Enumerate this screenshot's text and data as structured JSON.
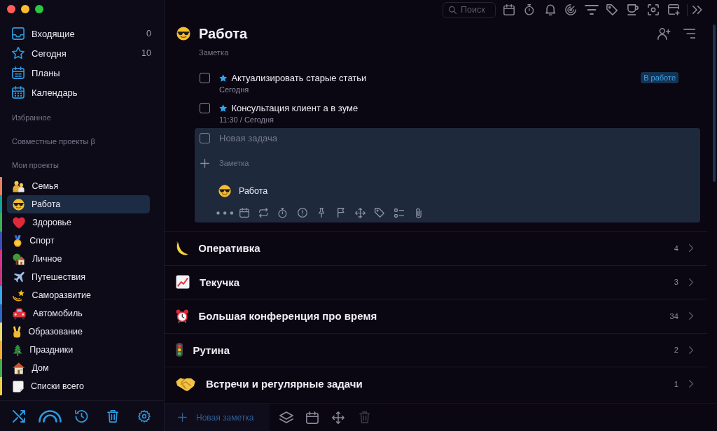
{
  "sidebar": {
    "nav": [
      {
        "kind": "inbox",
        "label": "Входящие",
        "count": "0",
        "selected": false
      },
      {
        "kind": "star",
        "label": "Сегодня",
        "count": "10",
        "selected": false
      },
      {
        "kind": "plans",
        "label": "Планы",
        "selected": false
      },
      {
        "kind": "calendar",
        "label": "Календарь",
        "selected": false
      }
    ],
    "favorites_heading": "Избранное",
    "shared_heading": "Совместные проекты β",
    "projects_heading": "Мои проекты",
    "projects": [
      {
        "kind": "family",
        "label": "Семья",
        "color": "#e8825a",
        "selected": false
      },
      {
        "kind": "cool",
        "label": "Работа",
        "color": "#14a394",
        "selected": true
      },
      {
        "kind": "heart",
        "label": "Здоровье",
        "color": "#3fae58",
        "selected": false
      },
      {
        "kind": "medal",
        "label": "Спорт",
        "color": "#3c4fbf",
        "selected": false
      },
      {
        "kind": "home-garden",
        "label": "Личное",
        "color": "#d6338a",
        "selected": false
      },
      {
        "kind": "airplane",
        "label": "Путешествия",
        "color": "#c8377d",
        "selected": false
      },
      {
        "kind": "dizzy",
        "label": "Саморазвитие",
        "color": "#39a6e6",
        "selected": false
      },
      {
        "kind": "car",
        "label": "Автомобиль",
        "color": "#2b68c6",
        "selected": false
      },
      {
        "kind": "victory",
        "label": "Образование",
        "color": "#e6de6e",
        "selected": false
      },
      {
        "kind": "tree",
        "label": "Праздники",
        "color": "#efae2f",
        "selected": false
      },
      {
        "kind": "home",
        "label": "Дом",
        "color": "#41ad4f",
        "selected": false
      },
      {
        "kind": "notepad",
        "label": "Списки всего",
        "color": "#efd041",
        "selected": false
      }
    ]
  },
  "toolbar": {
    "search": {
      "placeholder": "Поиск"
    }
  },
  "project": {
    "kind": "cool",
    "title": "Работа",
    "note": {
      "placeholder": "Заметка"
    },
    "tasks": [
      {
        "title": "Актуализировать старые статьи",
        "checked": false,
        "starred": true,
        "due": "Сегодня",
        "badge": "В работе"
      },
      {
        "title": "Консультация клиент а в зуме",
        "checked": false,
        "starred": true,
        "due": "11:30 / Сегодня"
      }
    ],
    "new_task": {
      "checked": false,
      "title": {
        "placeholder": "Новая задача"
      },
      "note": {
        "placeholder": "Заметка"
      },
      "project": {
        "kind": "cool",
        "label": "Работа"
      }
    },
    "sections": [
      {
        "kind": "banana",
        "title": "Оперативка",
        "count": "4"
      },
      {
        "kind": "chart",
        "title": "Текучка",
        "count": "3"
      },
      {
        "kind": "alarm",
        "title": "Большая конференция про время",
        "count": "34"
      },
      {
        "kind": "traffic",
        "title": "Рутина",
        "count": "2"
      },
      {
        "kind": "handshake",
        "title": "Встречи и регулярные задачи",
        "count": "1"
      }
    ]
  },
  "bottom_bar": {
    "new_note_label": "Новая заметка",
    "trash_disabled": true
  }
}
